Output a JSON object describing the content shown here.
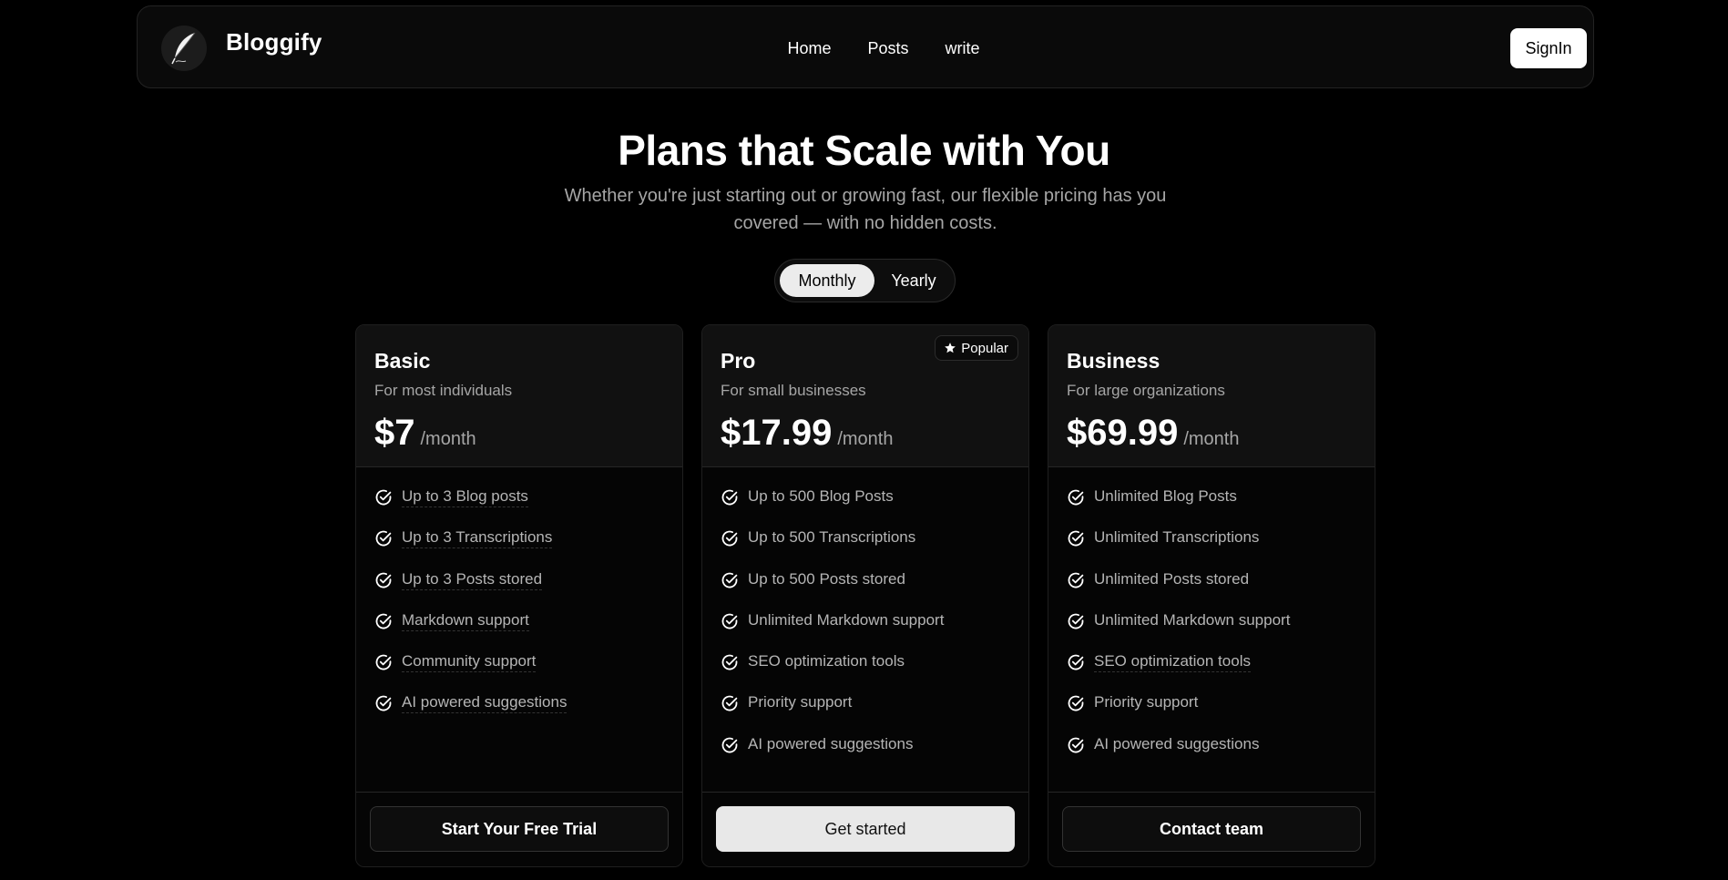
{
  "navbar": {
    "brand": "Bloggify",
    "logo_icon": "quill-feather-icon",
    "links": [
      "Home",
      "Posts",
      "write"
    ],
    "signin_label": "SignIn"
  },
  "hero": {
    "title": "Plans that Scale with You",
    "subtitle": "Whether you're just starting out or growing fast, our flexible pricing has you covered — with no hidden costs."
  },
  "billing_toggle": {
    "options": [
      "Monthly",
      "Yearly"
    ],
    "selected": "Monthly"
  },
  "plans": [
    {
      "name": "Basic",
      "description": "For most individuals",
      "price": "$7",
      "period": "/month",
      "features": [
        "Up to 3 Blog posts",
        "Up to 3 Transcriptions",
        "Up to 3 Posts stored",
        "Markdown support",
        "Community support",
        "AI powered suggestions"
      ],
      "cta": "Start Your Free Trial"
    },
    {
      "name": "Pro",
      "description": "For small businesses",
      "price": "$17.99",
      "period": "/month",
      "badge": "Popular",
      "badge_icon": "star-icon",
      "features": [
        "Up to 500 Blog Posts",
        "Up to 500 Transcriptions",
        "Up to 500 Posts stored",
        "Unlimited Markdown support",
        "SEO optimization tools",
        "Priority support",
        "AI powered suggestions"
      ],
      "cta": "Get started"
    },
    {
      "name": "Business",
      "description": "For large organizations",
      "price": "$69.99",
      "period": "/month",
      "features": [
        "Unlimited Blog Posts",
        "Unlimited Transcriptions",
        "Unlimited Posts stored",
        "Unlimited Markdown support",
        "SEO optimization tools",
        "Priority support",
        "AI powered suggestions"
      ],
      "cta": "Contact team"
    }
  ],
  "colors": {
    "background": "#000000",
    "card_header": "#111111",
    "primary_button": "#e8e8e8",
    "muted_text": "#a6a6a6"
  }
}
